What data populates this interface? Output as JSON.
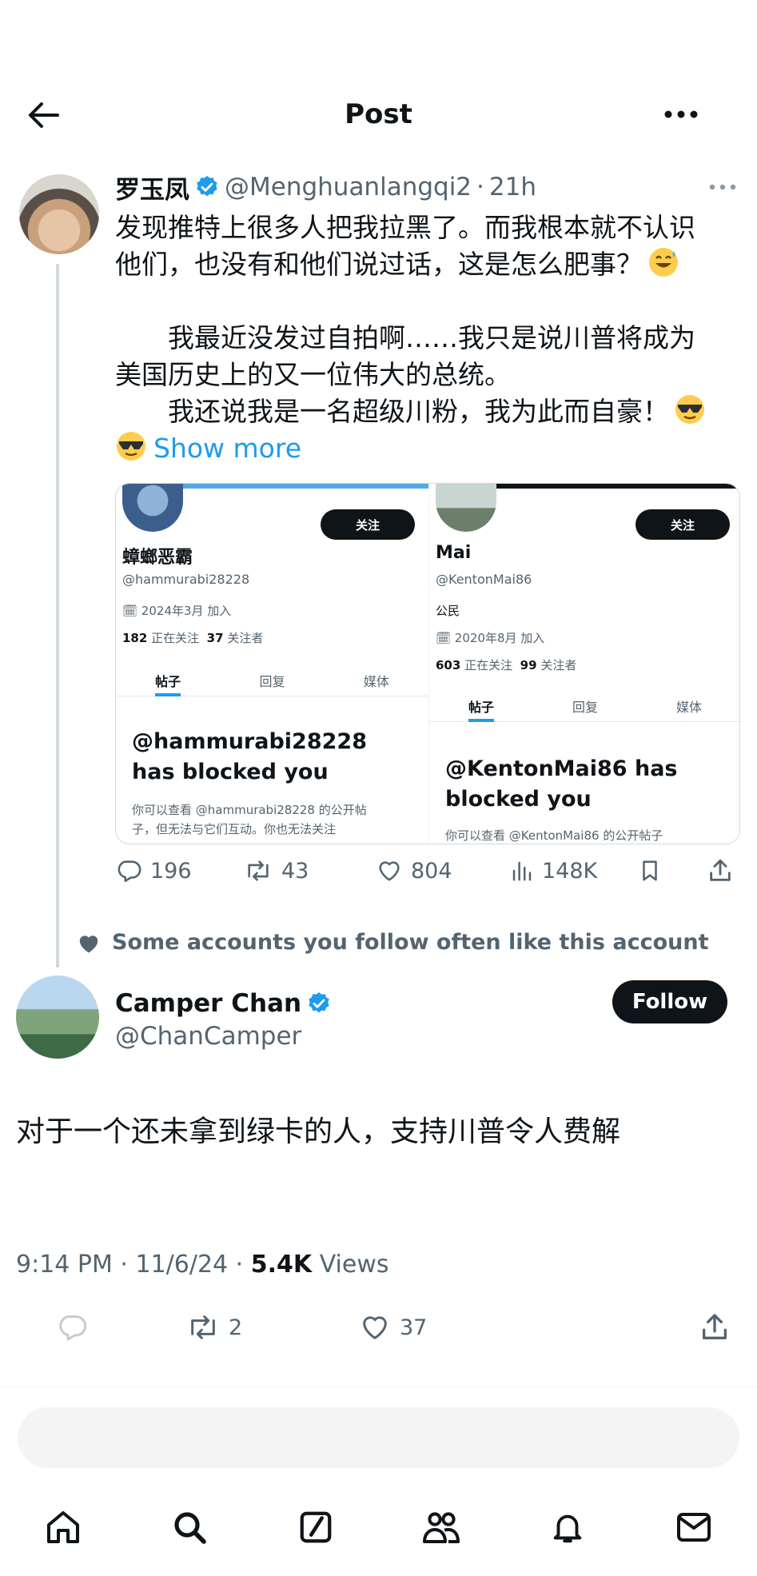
{
  "header": {
    "title": "Post"
  },
  "parent_tweet": {
    "name": "罗玉凤",
    "handle": "@Menghuanlangqi2",
    "separator": "·",
    "time": "21h",
    "lines": [
      "发现推特上很多人把我拉黑了。而我根本就不认识",
      "他们，也没有和他们说过话，这是怎么肥事？",
      "",
      "　　我最近没发过自拍啊……我只是说川普将成为",
      "美国历史上的又一位伟大的总统。",
      "　　我还说我是一名超级川粉，我为此而自豪！"
    ],
    "show_more": "Show more",
    "embed": {
      "left": {
        "follow": "关注",
        "name": "蟑螂恶霸",
        "handle": "@hammurabi28228",
        "joined": "🗓 2024年3月 加入",
        "following_count": "182",
        "following_label": "正在关注",
        "followers_count": "37",
        "followers_label": "关注者",
        "tabs": [
          "帖子",
          "回复",
          "媒体"
        ],
        "blocked_line1": "@hammurabi28228",
        "blocked_line2": "has blocked you",
        "fine_line1": "你可以查看 @hammurabi28228 的公开帖",
        "fine_line2": "子，但无法与它们互动。你也无法关注"
      },
      "right": {
        "follow": "关注",
        "name": "Mai",
        "handle": "@KentonMai86",
        "bio": "公民",
        "joined": "🗓 2020年8月 加入",
        "following_count": "603",
        "following_label": "正在关注",
        "followers_count": "99",
        "followers_label": "关注者",
        "tabs": [
          "帖子",
          "回复",
          "媒体"
        ],
        "blocked_line1": "@KentonMai86 has",
        "blocked_line2": "blocked you",
        "fine_line1": "你可以查看 @KentonMai86 的公开帖子"
      }
    },
    "stats": {
      "replies": "196",
      "reposts": "43",
      "likes": "804",
      "views": "148K"
    }
  },
  "social_context": "Some accounts you follow often like this account",
  "main_tweet": {
    "name": "Camper Chan",
    "handle": "@ChanCamper",
    "follow_label": "Follow",
    "text": "对于一个还未拿到绿卡的人，支持川普令人费解",
    "time": "9:14 PM · 11/6/24 · ",
    "views_count": "5.4K",
    "views_label": " Views",
    "stats": {
      "reposts": "2",
      "likes": "37"
    }
  },
  "colors": {
    "accent": "#1d9bf0",
    "text": "#0f1419",
    "secondary": "#536471"
  }
}
